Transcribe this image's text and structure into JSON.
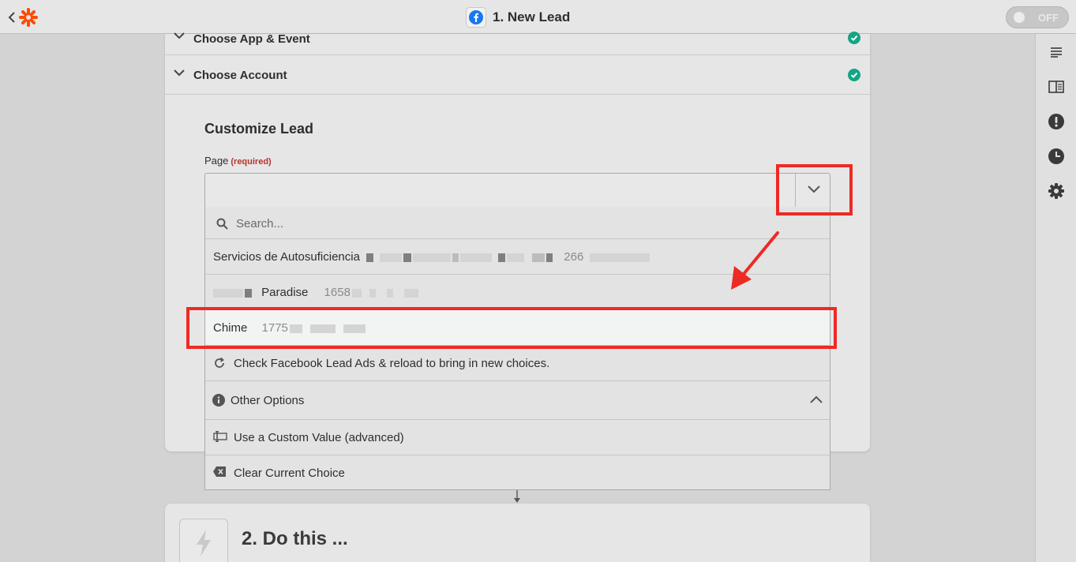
{
  "header": {
    "title": "1. New Lead",
    "toggle_label": "OFF",
    "brand_color": "#ff4a00",
    "facebook_color": "#1877f2"
  },
  "steps": {
    "choose_app": "Choose App & Event",
    "choose_account": "Choose Account",
    "section_title": "Customize Lead",
    "page_label": "Page",
    "page_required": "(required)",
    "success_color": "#13a584"
  },
  "dropdown": {
    "search_placeholder": "Search...",
    "options": [
      {
        "name": "Servicios de Autosuficiencia",
        "id_prefix": "266"
      },
      {
        "name": "Paradise",
        "id_prefix": "1658"
      },
      {
        "name": "Chime",
        "id_prefix": "1775"
      }
    ],
    "reload_text": "Check Facebook Lead Ads & reload to bring in new choices.",
    "other_options": "Other Options",
    "custom_value": "Use a Custom Value (advanced)",
    "clear_choice": "Clear Current Choice"
  },
  "step2": {
    "title": "2. Do this ..."
  },
  "annotation_color": "#ee2a24",
  "sidebar_icons": [
    "details-icon",
    "guide-book-icon",
    "alert-icon",
    "history-clock-icon",
    "settings-gear-icon"
  ]
}
